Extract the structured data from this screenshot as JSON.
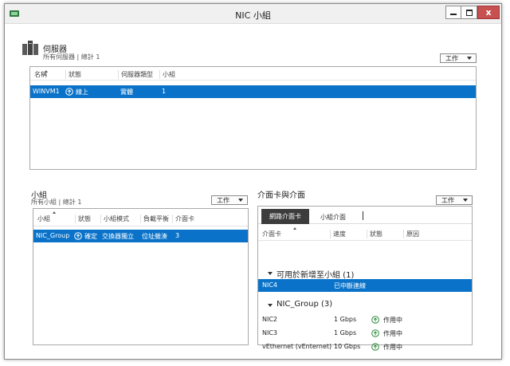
{
  "window": {
    "title": "NIC 小組",
    "close_glyph": "x"
  },
  "servers": {
    "title": "伺服器",
    "subtitle": "所有伺服器 | 總計 1",
    "task_label": "工作",
    "columns": [
      "名稱",
      "狀態",
      "伺服器類型",
      "小組"
    ],
    "rows": [
      {
        "name": "WINVM1",
        "status": "線上",
        "type": "實體",
        "teams": "1"
      }
    ]
  },
  "teams": {
    "title": "小組",
    "subtitle": "所有小組 | 總計 1",
    "task_label": "工作",
    "columns": [
      "小組",
      "狀態",
      "小組模式",
      "負載平衡",
      "介面卡"
    ],
    "rows": [
      {
        "team": "NIC_Group",
        "status": "確定",
        "mode": "交換器獨立",
        "lb": "位址雜湊",
        "adapters": "3"
      }
    ]
  },
  "adapters": {
    "title": "介面卡與介面",
    "task_label": "工作",
    "tabs": [
      "網路介面卡",
      "小組介面"
    ],
    "columns": [
      "介面卡",
      "速度",
      "狀態",
      "原因"
    ],
    "group_available": "可用於新增至小組 (1)",
    "available_rows": [
      {
        "name": "NIC4",
        "speed": "已中斷連線"
      }
    ],
    "group_team": "NIC_Group (3)",
    "team_rows": [
      {
        "name": "NIC2",
        "speed": "1 Gbps",
        "state": "作用中"
      },
      {
        "name": "NIC3",
        "speed": "1 Gbps",
        "state": "作用中"
      },
      {
        "name": "vEthernet (vEnternet)",
        "speed": "10 Gbps",
        "state": "作用中"
      }
    ]
  },
  "colors": {
    "selection": "#0a73c9",
    "ok_green": "#2d8a3a",
    "close_red": "#c75050"
  }
}
